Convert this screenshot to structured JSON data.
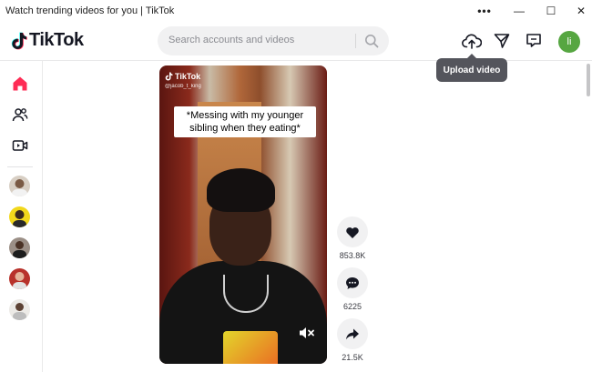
{
  "window": {
    "title": "Watch trending videos for you | TikTok",
    "more_label": "•••",
    "min_label": "—",
    "max_label": "☐",
    "close_label": "✕"
  },
  "header": {
    "logo_text": "TikTok",
    "search_placeholder": "Search accounts and videos",
    "avatar_initials": "li",
    "tooltip": "Upload video"
  },
  "video": {
    "watermark": "TikTok",
    "watermark_user": "@jacob_t_king",
    "caption": "*Messing with my younger sibling when they eating*"
  },
  "actions": {
    "likes": "853.8K",
    "comments": "6225",
    "shares": "21.5K"
  },
  "colors": {
    "brand": "#fe2c55",
    "avatar": "#56a641"
  }
}
